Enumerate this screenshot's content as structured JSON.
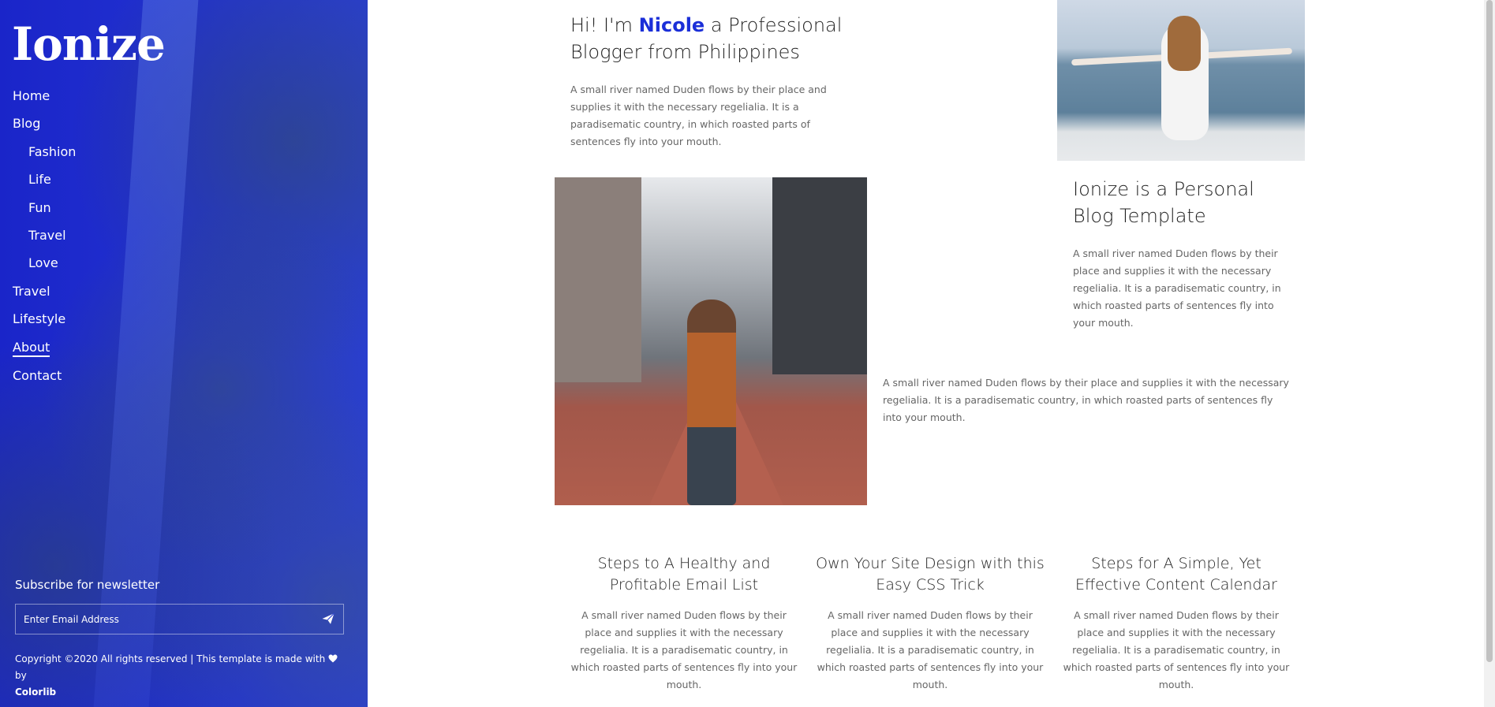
{
  "sidebar": {
    "logo": "Ionize",
    "nav": [
      {
        "label": "Home"
      },
      {
        "label": "Blog"
      },
      {
        "label": "Fashion"
      },
      {
        "label": "Life"
      },
      {
        "label": "Fun"
      },
      {
        "label": "Travel"
      },
      {
        "label": "Love"
      },
      {
        "label": "Travel"
      },
      {
        "label": "Lifestyle"
      },
      {
        "label": "About"
      },
      {
        "label": "Contact"
      }
    ],
    "subscribe_title": "Subscribe for newsletter",
    "email_placeholder": "Enter Email Address",
    "copyright_text": "Copyright ©2020 All rights reserved | This template is made with",
    "copyright_by": "by",
    "copyright_link": "Colorlib"
  },
  "main": {
    "hero_prefix": "Hi! I'm",
    "hero_name": "Nicole",
    "hero_suffix": "a Professional Blogger from Philippines",
    "hero_text": "A small river named Duden flows by their place and supplies it with the necessary regelialia. It is a paradisematic country, in which roasted parts of sentences fly into your mouth.",
    "section2_title": "Ionize is a Personal Blog Template",
    "section2_text": "A small river named Duden flows by their place and supplies it with the necessary regelialia. It is a paradisematic country, in which roasted parts of sentences fly into your mouth.",
    "middle_text": "A small river named Duden flows by their place and supplies it with the necessary regelialia. It is a paradisematic country, in which roasted parts of sentences fly into your mouth.",
    "cards": [
      {
        "title": "Steps to A Healthy and Profitable Email List",
        "text": "A small river named Duden flows by their place and supplies it with the necessary regelialia. It is a paradisematic country, in which roasted parts of sentences fly into your mouth."
      },
      {
        "title": "Own Your Site Design with this Easy CSS Trick",
        "text": "A small river named Duden flows by their place and supplies it with the necessary regelialia. It is a paradisematic country, in which roasted parts of sentences fly into your mouth."
      },
      {
        "title": "Steps for A Simple, Yet Effective Content Calendar",
        "text": "A small river named Duden flows by their place and supplies it with the necessary regelialia. It is a paradisematic country, in which roasted parts of sentences fly into your mouth."
      }
    ]
  },
  "colors": {
    "accent": "#1b2fd8",
    "sidebar_overlay": "#2a3fd6"
  },
  "icons": {
    "send": "paper-plane-icon",
    "heart": "heart-icon"
  }
}
